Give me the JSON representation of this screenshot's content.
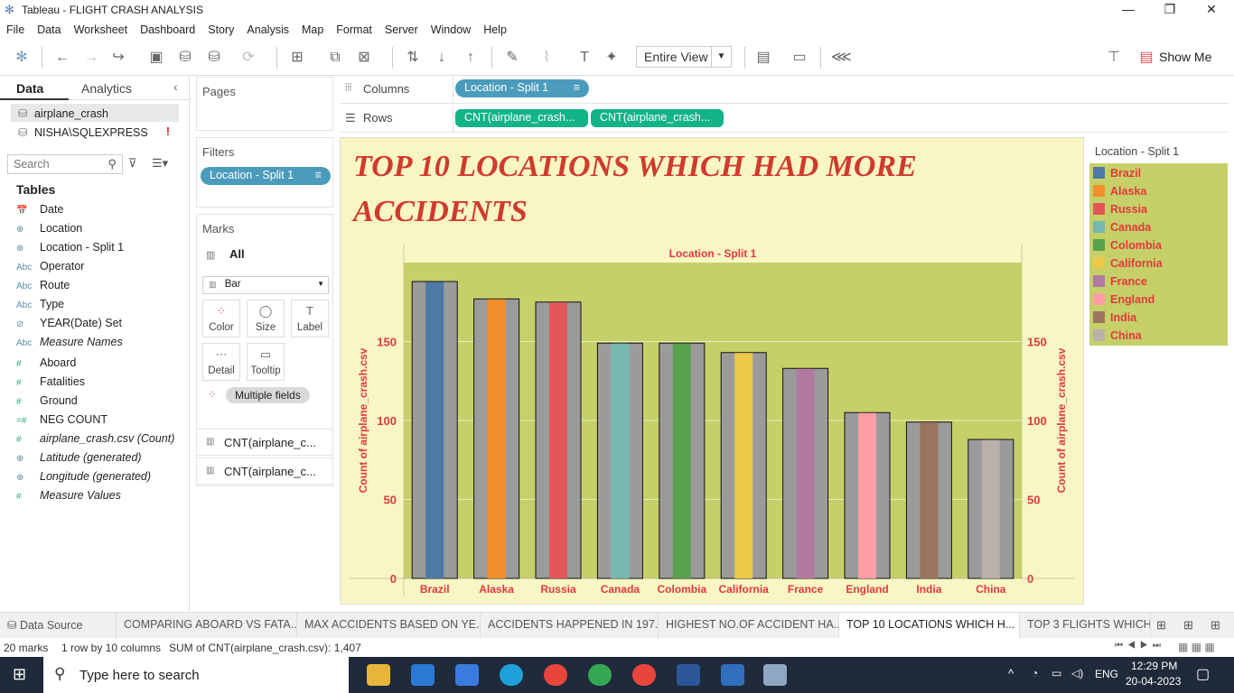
{
  "window": {
    "title": "Tableau - FLIGHT CRASH ANALYSIS",
    "minimize": "—",
    "restore": "❐",
    "close": "✕"
  },
  "menu": [
    "File",
    "Data",
    "Worksheet",
    "Dashboard",
    "Story",
    "Analysis",
    "Map",
    "Format",
    "Server",
    "Window",
    "Help"
  ],
  "toolbar": {
    "fit_value": "Entire View",
    "show_me": "Show Me"
  },
  "left_panel": {
    "tab_data": "Data",
    "tab_analytics": "Analytics",
    "datasource": "airplane_crash",
    "connection": "NISHA\\SQLEXPRESS",
    "search_placeholder": "Search",
    "tables_header": "Tables",
    "fields": [
      {
        "icon": "date-icon",
        "glyph": "📅",
        "name": "Date",
        "italic": false
      },
      {
        "icon": "globe-icon",
        "glyph": "⊕",
        "name": "Location",
        "italic": false
      },
      {
        "icon": "globe-icon",
        "glyph": "⊕",
        "name": "Location - Split 1",
        "italic": false
      },
      {
        "icon": "string-icon",
        "glyph": "Abc",
        "name": "Operator",
        "italic": false
      },
      {
        "icon": "string-icon",
        "glyph": "Abc",
        "name": "Route",
        "italic": false
      },
      {
        "icon": "string-icon",
        "glyph": "Abc",
        "name": "Type",
        "italic": false
      },
      {
        "icon": "set-icon",
        "glyph": "⊘",
        "name": "YEAR(Date) Set",
        "italic": false
      },
      {
        "icon": "string-icon",
        "glyph": "Abc",
        "name": "Measure Names",
        "italic": true
      },
      {
        "icon": "number-icon",
        "glyph": "#",
        "name": "Aboard",
        "italic": false
      },
      {
        "icon": "number-icon",
        "glyph": "#",
        "name": "Fatalities",
        "italic": false
      },
      {
        "icon": "number-icon",
        "glyph": "#",
        "name": "Ground",
        "italic": false
      },
      {
        "icon": "calc-number-icon",
        "glyph": "=#",
        "name": "NEG COUNT",
        "italic": false
      },
      {
        "icon": "number-icon",
        "glyph": "#",
        "name": "airplane_crash.csv (Count)",
        "italic": true
      },
      {
        "icon": "globe-icon",
        "glyph": "⊕",
        "name": "Latitude (generated)",
        "italic": true
      },
      {
        "icon": "globe-icon",
        "glyph": "⊕",
        "name": "Longitude (generated)",
        "italic": true
      },
      {
        "icon": "number-icon",
        "glyph": "#",
        "name": "Measure Values",
        "italic": true
      }
    ]
  },
  "cards": {
    "pages": "Pages",
    "filters": "Filters",
    "filter_pill": "Location - Split 1",
    "marks": "Marks",
    "marks_all": "All",
    "mark_type": "Bar",
    "mark_buttons": [
      "Color",
      "Size",
      "Label",
      "Detail",
      "Tooltip"
    ],
    "multiple_fields": "Multiple fields",
    "measure_cards": [
      "CNT(airplane_c...",
      "CNT(airplane_c..."
    ]
  },
  "shelves": {
    "columns_label": "Columns",
    "columns_pill": "Location - Split 1",
    "rows_label": "Rows",
    "rows_pills": [
      "CNT(airplane_crash...",
      "CNT(airplane_crash..."
    ]
  },
  "chart_data": {
    "type": "bar",
    "title": "TOP 10 LOCATIONS WHICH HAD MORE ACCIDENTS",
    "header": "Location - Split 1",
    "ylabel": "Count of airplane_crash.csv",
    "ylabel_right": "Count of airplane_crash.csv",
    "categories": [
      "Brazil",
      "Alaska",
      "Russia",
      "Canada",
      "Colombia",
      "California",
      "France",
      "England",
      "India",
      "China"
    ],
    "values": [
      188,
      177,
      175,
      149,
      149,
      143,
      133,
      105,
      99,
      88
    ],
    "colors": [
      "#4e79a7",
      "#f28e2b",
      "#e15759",
      "#76b7b2",
      "#59a14f",
      "#edc948",
      "#b07aa1",
      "#ff9da7",
      "#9c755f",
      "#bab0ac"
    ],
    "ylim": [
      0,
      200
    ],
    "yticks": [
      0,
      50,
      100,
      150
    ],
    "dual_axis": true,
    "grid": true,
    "background": "#c6d068",
    "page_background": "#f8f6c2",
    "title_color": "#d03a2e",
    "label_color": "#e0393e"
  },
  "legend": {
    "title": "Location - Split 1"
  },
  "sheet_tabs": [
    "Data Source",
    "COMPARING ABOARD VS FATA...",
    "MAX ACCIDENTS BASED ON YE...",
    "ACCIDENTS HAPPENED IN 197...",
    "HIGHEST NO.OF ACCIDENT HA...",
    "TOP 10 LOCATIONS WHICH H...",
    "TOP 3 FLIGHTS WHICH"
  ],
  "status": {
    "marks": "20 marks",
    "rows_cols": "1 row by 10 columns",
    "sum": "SUM of CNT(airplane_crash.csv): 1,407"
  },
  "taskbar": {
    "search": "Type here to search",
    "lang": "ENG",
    "time": "12:29 PM",
    "date": "20-04-2023"
  }
}
